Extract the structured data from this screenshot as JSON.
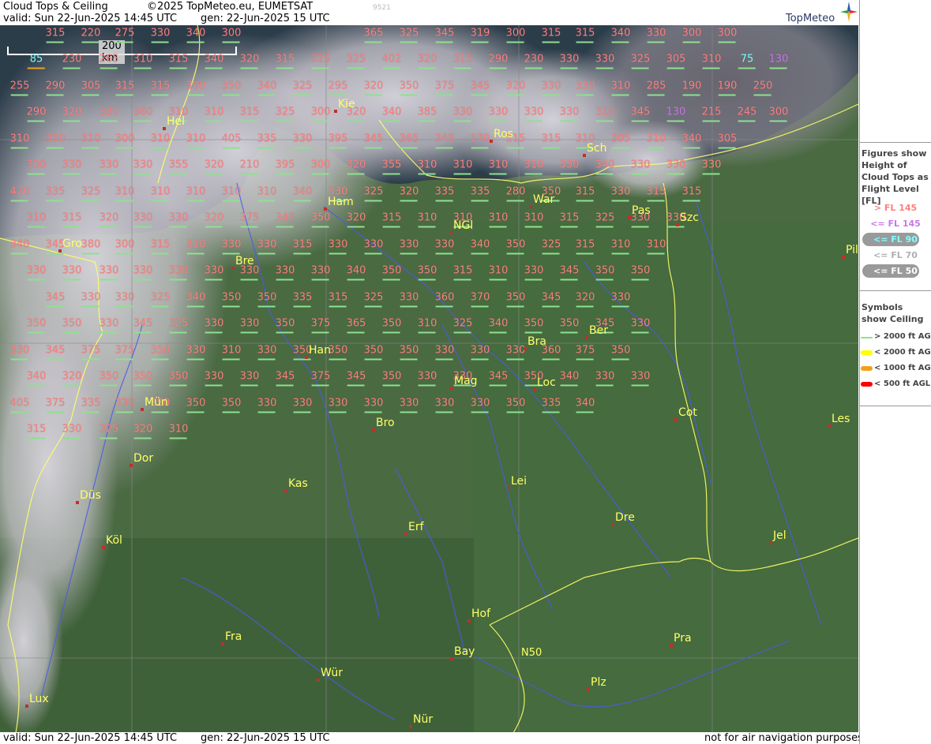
{
  "header": {
    "title": "Cloud Tops & Ceiling",
    "copyright": "©2025 TopMeteo.eu, EUMETSAT",
    "valid": "valid:  Sun  22-Jun-2025  14:45 UTC",
    "gen": "gen: 22-Jun-2025 15 UTC",
    "code": "9521",
    "logo": "TopMeteo"
  },
  "footer": {
    "valid": "valid:  Sun  22-Jun-2025  14:45 UTC",
    "gen": "gen: 22-Jun-2025 15 UTC",
    "note": "not for air navigation purposes"
  },
  "scale": {
    "label": "200 km"
  },
  "grid_label": "N50",
  "legend": {
    "title": "Figures show Height of Cloud Tops as Flight Level  [FL]",
    "levels": [
      {
        "label": "> FL 145",
        "color": "#ff7f7f",
        "pill": false
      },
      {
        "label": "<= FL 145",
        "color": "#c878e8",
        "pill": false
      },
      {
        "label": "<= FL 90",
        "color": "#7fffff",
        "pill": true
      },
      {
        "label": "<= FL 70",
        "color": "#b0b0b0",
        "pill": false
      },
      {
        "label": "<= FL 50",
        "color": "#ffffff",
        "pill": true
      }
    ],
    "symbols_title": "Symbols show Ceiling",
    "symbols": [
      {
        "label": "> 2000 ft AGL",
        "color": "#8fe08f"
      },
      {
        "label": "< 2000 ft AGL",
        "color": "#ffff00"
      },
      {
        "label": "< 1000 ft AGL",
        "color": "#f0a020"
      },
      {
        "label": "< 500 ft AGL",
        "color": "#ff0000"
      }
    ]
  },
  "cities": [
    {
      "name": "Hel"
    },
    {
      "name": "Kie"
    },
    {
      "name": "Ros"
    },
    {
      "name": "Sch"
    },
    {
      "name": "Ham"
    },
    {
      "name": "War"
    },
    {
      "name": "Pas"
    },
    {
      "name": "Szc"
    },
    {
      "name": "NGl"
    },
    {
      "name": "Gro"
    },
    {
      "name": "Bre"
    },
    {
      "name": "Han"
    },
    {
      "name": "Bra"
    },
    {
      "name": "Ber"
    },
    {
      "name": "Mag"
    },
    {
      "name": "Loc"
    },
    {
      "name": "Mün"
    },
    {
      "name": "Bro"
    },
    {
      "name": "Cot"
    },
    {
      "name": "Les"
    },
    {
      "name": "Dor"
    },
    {
      "name": "Kas"
    },
    {
      "name": "Lei"
    },
    {
      "name": "Düs"
    },
    {
      "name": "Erf"
    },
    {
      "name": "Dre"
    },
    {
      "name": "Köl"
    },
    {
      "name": "Jel"
    },
    {
      "name": "Hof"
    },
    {
      "name": "Fra"
    },
    {
      "name": "Bay"
    },
    {
      "name": "Pra"
    },
    {
      "name": "Wür"
    },
    {
      "name": "Plz"
    },
    {
      "name": "Lux"
    },
    {
      "name": "Nür"
    },
    {
      "name": "Pil"
    }
  ],
  "labels": [
    {
      "t": "315"
    },
    {
      "t": "220"
    },
    {
      "t": "275"
    },
    {
      "t": "330"
    },
    {
      "t": "340"
    },
    {
      "t": "300"
    },
    {
      "t": "365"
    },
    {
      "t": "325"
    },
    {
      "t": "345"
    },
    {
      "t": "319"
    },
    {
      "t": "300"
    },
    {
      "t": "315"
    },
    {
      "t": "315"
    },
    {
      "t": "340"
    },
    {
      "t": "330"
    },
    {
      "t": "300"
    },
    {
      "t": "300"
    },
    {
      "t": "85"
    },
    {
      "t": "230"
    },
    {
      "t": "265"
    },
    {
      "t": "310"
    },
    {
      "t": "315"
    },
    {
      "t": "340"
    },
    {
      "t": "320"
    },
    {
      "t": "315"
    },
    {
      "t": "325"
    },
    {
      "t": "325"
    },
    {
      "t": "402"
    },
    {
      "t": "320"
    },
    {
      "t": "315"
    },
    {
      "t": "290"
    },
    {
      "t": "230"
    },
    {
      "t": "330"
    },
    {
      "t": "330"
    },
    {
      "t": "325"
    },
    {
      "t": "305"
    },
    {
      "t": "310"
    },
    {
      "t": "75"
    },
    {
      "t": "130"
    },
    {
      "t": "255"
    },
    {
      "t": "290"
    },
    {
      "t": "305"
    },
    {
      "t": "315"
    },
    {
      "t": "315"
    },
    {
      "t": "300"
    },
    {
      "t": "350"
    },
    {
      "t": "340"
    },
    {
      "t": "325"
    },
    {
      "t": "295"
    },
    {
      "t": "320"
    },
    {
      "t": "350"
    },
    {
      "t": "375"
    },
    {
      "t": "345"
    },
    {
      "t": "320"
    },
    {
      "t": "330"
    },
    {
      "t": "330"
    },
    {
      "t": "310"
    },
    {
      "t": "285"
    },
    {
      "t": "190"
    },
    {
      "t": "190"
    },
    {
      "t": "250"
    },
    {
      "t": "290"
    },
    {
      "t": "320"
    },
    {
      "t": "330"
    },
    {
      "t": "360"
    },
    {
      "t": "310"
    },
    {
      "t": "310"
    },
    {
      "t": "315"
    },
    {
      "t": "325"
    },
    {
      "t": "300"
    },
    {
      "t": "320"
    },
    {
      "t": "340"
    },
    {
      "t": "385"
    },
    {
      "t": "330"
    },
    {
      "t": "330"
    },
    {
      "t": "330"
    },
    {
      "t": "330"
    },
    {
      "t": "310"
    },
    {
      "t": "345"
    },
    {
      "t": "130"
    },
    {
      "t": "215"
    },
    {
      "t": "245"
    },
    {
      "t": "300"
    },
    {
      "t": "310"
    },
    {
      "t": "330"
    },
    {
      "t": "310"
    },
    {
      "t": "300"
    },
    {
      "t": "310"
    },
    {
      "t": "310"
    },
    {
      "t": "405"
    },
    {
      "t": "335"
    },
    {
      "t": "330"
    },
    {
      "t": "395"
    },
    {
      "t": "345"
    },
    {
      "t": "365"
    },
    {
      "t": "345"
    },
    {
      "t": "170"
    },
    {
      "t": "215"
    },
    {
      "t": "315"
    },
    {
      "t": "310"
    },
    {
      "t": "305"
    },
    {
      "t": "310"
    },
    {
      "t": "340"
    },
    {
      "t": "305"
    },
    {
      "t": "330"
    },
    {
      "t": "330"
    },
    {
      "t": "330"
    },
    {
      "t": "330"
    },
    {
      "t": "355"
    },
    {
      "t": "320"
    },
    {
      "t": "210"
    },
    {
      "t": "395"
    },
    {
      "t": "300"
    },
    {
      "t": "320"
    },
    {
      "t": "355"
    },
    {
      "t": "310"
    },
    {
      "t": "310"
    },
    {
      "t": "310"
    },
    {
      "t": "310"
    },
    {
      "t": "330"
    },
    {
      "t": "340"
    },
    {
      "t": "330"
    },
    {
      "t": "330"
    },
    {
      "t": "330"
    },
    {
      "t": "420"
    },
    {
      "t": "335"
    },
    {
      "t": "325"
    },
    {
      "t": "310"
    },
    {
      "t": "310"
    },
    {
      "t": "310"
    },
    {
      "t": "310"
    },
    {
      "t": "310"
    },
    {
      "t": "340"
    },
    {
      "t": "330"
    },
    {
      "t": "325"
    },
    {
      "t": "320"
    },
    {
      "t": "335"
    },
    {
      "t": "335"
    },
    {
      "t": "280"
    },
    {
      "t": "350"
    },
    {
      "t": "315"
    },
    {
      "t": "330"
    },
    {
      "t": "315"
    },
    {
      "t": "315"
    },
    {
      "t": "310"
    },
    {
      "t": "315"
    },
    {
      "t": "320"
    },
    {
      "t": "330"
    },
    {
      "t": "330"
    },
    {
      "t": "320"
    },
    {
      "t": "375"
    },
    {
      "t": "345"
    },
    {
      "t": "350"
    },
    {
      "t": "320"
    },
    {
      "t": "315"
    },
    {
      "t": "310"
    },
    {
      "t": "310"
    },
    {
      "t": "310"
    },
    {
      "t": "310"
    },
    {
      "t": "315"
    },
    {
      "t": "325"
    },
    {
      "t": "330"
    },
    {
      "t": "330"
    },
    {
      "t": "340"
    },
    {
      "t": "345"
    },
    {
      "t": "380"
    },
    {
      "t": "300"
    },
    {
      "t": "315"
    },
    {
      "t": "310"
    },
    {
      "t": "330"
    },
    {
      "t": "330"
    },
    {
      "t": "315"
    },
    {
      "t": "330"
    },
    {
      "t": "330"
    },
    {
      "t": "330"
    },
    {
      "t": "330"
    },
    {
      "t": "340"
    },
    {
      "t": "350"
    },
    {
      "t": "325"
    },
    {
      "t": "315"
    },
    {
      "t": "310"
    },
    {
      "t": "310"
    },
    {
      "t": "330"
    },
    {
      "t": "330"
    },
    {
      "t": "330"
    },
    {
      "t": "330"
    },
    {
      "t": "330"
    },
    {
      "t": "330"
    },
    {
      "t": "330"
    },
    {
      "t": "330"
    },
    {
      "t": "330"
    },
    {
      "t": "340"
    },
    {
      "t": "350"
    },
    {
      "t": "350"
    },
    {
      "t": "315"
    },
    {
      "t": "310"
    },
    {
      "t": "330"
    },
    {
      "t": "345"
    },
    {
      "t": "350"
    },
    {
      "t": "350"
    },
    {
      "t": "345"
    },
    {
      "t": "330"
    },
    {
      "t": "330"
    },
    {
      "t": "325"
    },
    {
      "t": "340"
    },
    {
      "t": "350"
    },
    {
      "t": "350"
    },
    {
      "t": "335"
    },
    {
      "t": "315"
    },
    {
      "t": "325"
    },
    {
      "t": "330"
    },
    {
      "t": "360"
    },
    {
      "t": "370"
    },
    {
      "t": "350"
    },
    {
      "t": "345"
    },
    {
      "t": "320"
    },
    {
      "t": "330"
    },
    {
      "t": "350"
    },
    {
      "t": "350"
    },
    {
      "t": "330"
    },
    {
      "t": "345"
    },
    {
      "t": "325"
    },
    {
      "t": "330"
    },
    {
      "t": "330"
    },
    {
      "t": "350"
    },
    {
      "t": "375"
    },
    {
      "t": "365"
    },
    {
      "t": "350"
    },
    {
      "t": "310"
    },
    {
      "t": "325"
    },
    {
      "t": "340"
    },
    {
      "t": "350"
    },
    {
      "t": "350"
    },
    {
      "t": "345"
    },
    {
      "t": "330"
    },
    {
      "t": "330"
    },
    {
      "t": "345"
    },
    {
      "t": "375"
    },
    {
      "t": "375"
    },
    {
      "t": "350"
    },
    {
      "t": "330"
    },
    {
      "t": "310"
    },
    {
      "t": "330"
    },
    {
      "t": "350"
    },
    {
      "t": "350"
    },
    {
      "t": "350"
    },
    {
      "t": "350"
    },
    {
      "t": "330"
    },
    {
      "t": "330"
    },
    {
      "t": "330"
    },
    {
      "t": "360"
    },
    {
      "t": "375"
    },
    {
      "t": "350"
    },
    {
      "t": "340"
    },
    {
      "t": "320"
    },
    {
      "t": "350"
    },
    {
      "t": "350"
    },
    {
      "t": "350"
    },
    {
      "t": "330"
    },
    {
      "t": "330"
    },
    {
      "t": "345"
    },
    {
      "t": "375"
    },
    {
      "t": "345"
    },
    {
      "t": "350"
    },
    {
      "t": "330"
    },
    {
      "t": "330"
    },
    {
      "t": "345"
    },
    {
      "t": "350"
    },
    {
      "t": "340"
    },
    {
      "t": "330"
    },
    {
      "t": "330"
    },
    {
      "t": "405"
    },
    {
      "t": "375"
    },
    {
      "t": "335"
    },
    {
      "t": "330"
    },
    {
      "t": "350"
    },
    {
      "t": "350"
    },
    {
      "t": "350"
    },
    {
      "t": "330"
    },
    {
      "t": "330"
    },
    {
      "t": "330"
    },
    {
      "t": "330"
    },
    {
      "t": "330"
    },
    {
      "t": "330"
    },
    {
      "t": "330"
    },
    {
      "t": "350"
    },
    {
      "t": "335"
    },
    {
      "t": "340"
    },
    {
      "t": "315"
    },
    {
      "t": "330"
    },
    {
      "t": "325"
    },
    {
      "t": "320"
    },
    {
      "t": "310"
    }
  ]
}
